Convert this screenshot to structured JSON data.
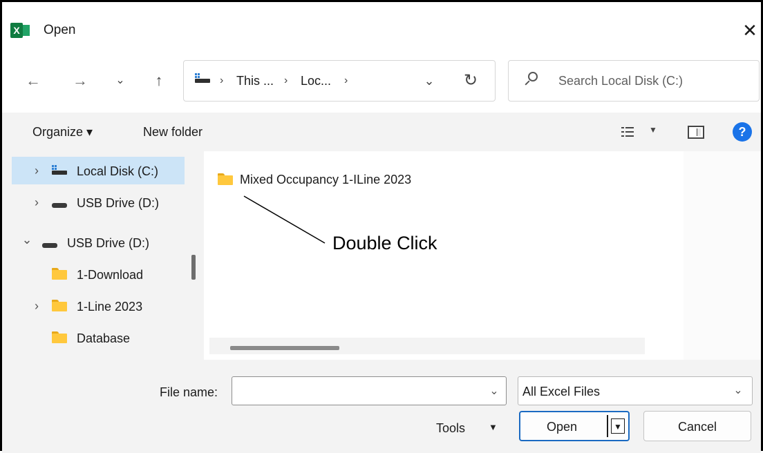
{
  "window": {
    "title": "Open",
    "app_icon": "excel-icon",
    "close_glyph": "✕"
  },
  "nav": {
    "back_glyph": "←",
    "forward_glyph": "→",
    "recent_glyph": "⌄",
    "up_glyph": "↑"
  },
  "address": {
    "crumbs": [
      "This ...",
      "Loc..."
    ],
    "sep": "›",
    "dropdown_glyph": "⌄",
    "refresh_glyph": "↻"
  },
  "search": {
    "placeholder": "Search Local Disk (C:)"
  },
  "toolbar": {
    "organize_label": "Organize ▾",
    "new_folder_label": "New folder",
    "view_caret": "▼",
    "help_glyph": "?"
  },
  "sidebar": {
    "items": [
      {
        "label": "Local Disk (C:)",
        "chevron": "›",
        "icon": "local-disk-icon",
        "selected": true
      },
      {
        "label": "USB Drive (D:)",
        "chevron": "›",
        "icon": "usb-drive-icon"
      },
      {
        "label": "USB Drive (D:)",
        "chevron": "⌄",
        "icon": "usb-drive-icon"
      },
      {
        "label": "1-Download",
        "chevron": "",
        "icon": "folder-icon"
      },
      {
        "label": "1-Line 2023",
        "chevron": "›",
        "icon": "folder-icon"
      },
      {
        "label": "Database",
        "chevron": "",
        "icon": "folder-icon"
      }
    ]
  },
  "files": {
    "items": [
      {
        "label": "Mixed Occupancy 1-ILine 2023",
        "icon": "folder-icon"
      }
    ]
  },
  "annotation": {
    "text": "Double Click"
  },
  "bottom": {
    "file_name_label": "File name:",
    "file_name_value": "",
    "dropdown_glyph": "⌄",
    "filter_value": "All Excel Files",
    "tools_label": "Tools",
    "tools_caret": "▼",
    "open_label": "Open",
    "open_caret": "▼",
    "cancel_label": "Cancel"
  },
  "colors": {
    "accent": "#1a6ac2",
    "selection": "#cce4f7",
    "folder": "#ffc83d",
    "excel_green": "#107c41"
  }
}
